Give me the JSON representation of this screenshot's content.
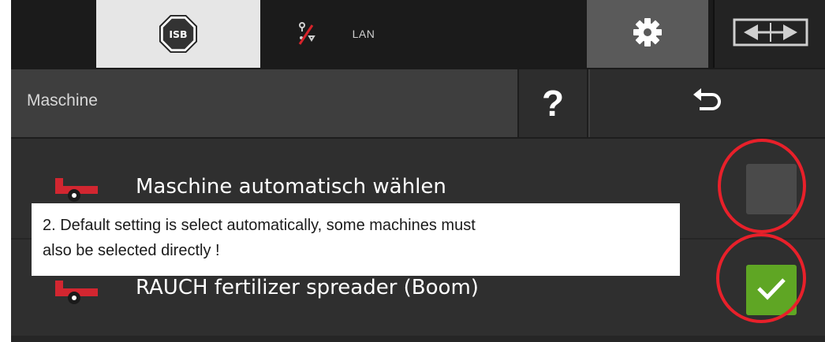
{
  "topbar": {
    "isb_label": "ISB",
    "lan_label": "LAN",
    "icons": {
      "isb": "isb-octagon-icon",
      "lan": "lan-disconnected-icon",
      "settings": "gear-icon",
      "switch": "screen-switch-icon"
    }
  },
  "header": {
    "title": "Maschine",
    "help_label": "?",
    "back_icon": "undo-arrow-icon"
  },
  "list": {
    "items": [
      {
        "label": "Maschine automatisch wählen",
        "checked": false,
        "icon": "trailer-icon"
      },
      {
        "label": "RAUCH fertilizer spreader (Boom)",
        "checked": true,
        "icon": "trailer-icon"
      }
    ]
  },
  "annotation": {
    "line1": "2. Default setting is select automatically, some machines must",
    "line2": "also be selected directly !"
  },
  "colors": {
    "accent_red": "#e8202a",
    "check_green": "#5fa624",
    "machine_red": "#d22630"
  }
}
